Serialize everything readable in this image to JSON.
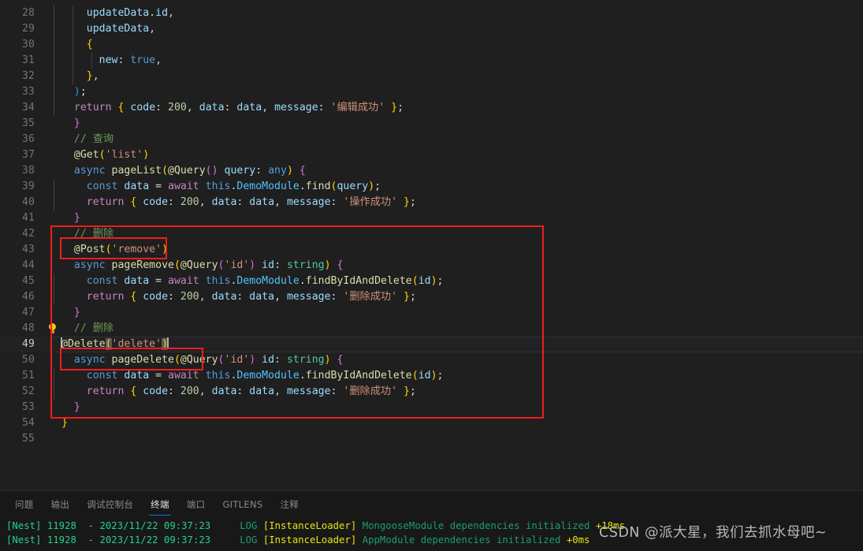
{
  "editor": {
    "first_visible_line": 28,
    "last_visible_line": 55,
    "active_line": 49,
    "lines": [
      {
        "num": "28",
        "text": "    updateData.id,"
      },
      {
        "num": "29",
        "text": "    updateData,"
      },
      {
        "num": "30",
        "text": "    {"
      },
      {
        "num": "31",
        "text": "      new: true,"
      },
      {
        "num": "32",
        "text": "    },"
      },
      {
        "num": "33",
        "text": "  );"
      },
      {
        "num": "34",
        "text": "  return { code: 200, data: data, message: '编辑成功' };"
      },
      {
        "num": "35",
        "text": "}"
      },
      {
        "num": "36",
        "text": "// 查询"
      },
      {
        "num": "37",
        "text": "@Get('list')"
      },
      {
        "num": "38",
        "text": "async pageList(@Query() query: any) {"
      },
      {
        "num": "39",
        "text": "  const data = await this.DemoModule.find(query);"
      },
      {
        "num": "40",
        "text": "  return { code: 200, data: data, message: '操作成功' };"
      },
      {
        "num": "41",
        "text": "}"
      },
      {
        "num": "42",
        "text": "// 删除"
      },
      {
        "num": "43",
        "text": "@Post('remove')"
      },
      {
        "num": "44",
        "text": "async pageRemove(@Query('id') id: string) {"
      },
      {
        "num": "45",
        "text": "  const data = await this.DemoModule.findByIdAndDelete(id);"
      },
      {
        "num": "46",
        "text": "  return { code: 200, data: data, message: '删除成功' };"
      },
      {
        "num": "47",
        "text": "}"
      },
      {
        "num": "48",
        "text": "// 删除"
      },
      {
        "num": "49",
        "text": "@Delete('delete')"
      },
      {
        "num": "50",
        "text": "async pageDelete(@Query('id') id: string) {"
      },
      {
        "num": "51",
        "text": "  const data = await this.DemoModule.findByIdAndDelete(id);"
      },
      {
        "num": "52",
        "text": "  return { code: 200, data: data, message: '删除成功' };"
      },
      {
        "num": "53",
        "text": "}"
      },
      {
        "num": "54",
        "text": "}"
      },
      {
        "num": "55",
        "text": ""
      }
    ],
    "tokens": {
      "const": "const",
      "await": "await",
      "return": "return",
      "async": "async",
      "new_prop": "new",
      "true": "true",
      "this": "this",
      "DemoModule": "DemoModule",
      "find": "find",
      "findByIdAndDelete": "findByIdAndDelete",
      "data": "data",
      "code": "code",
      "message": "message",
      "query": "query",
      "id": "id",
      "any": "any",
      "string": "string",
      "updateData": "updateData",
      "code_value": "200",
      "decorator_get": "@Get",
      "decorator_post": "@Post",
      "decorator_delete": "@Delete",
      "decorator_query": "@Query",
      "str_list": "'list'",
      "str_remove": "'remove'",
      "str_delete": "'delete'",
      "str_id": "'id'",
      "msg_edit": "'编辑成功'",
      "msg_op": "'操作成功'",
      "msg_del": "'删除成功'",
      "fn_pageList": "pageList",
      "fn_pageRemove": "pageRemove",
      "fn_pageDelete": "pageDelete",
      "comment_query": "// 查询",
      "comment_delete": "// 删除"
    },
    "quick_fix_line": 48,
    "quick_fix_icon": "lightbulb-icon"
  },
  "annotations": {
    "outer_box_label": "highlighted-delete-methods",
    "post_box_label": "post-remove-decorator",
    "delete_box_label": "delete-decorator",
    "color": "#f01c1c"
  },
  "panel": {
    "tabs": [
      {
        "label": "问题",
        "name": "tab-problems",
        "active": false
      },
      {
        "label": "输出",
        "name": "tab-output",
        "active": false
      },
      {
        "label": "调试控制台",
        "name": "tab-debug-console",
        "active": false
      },
      {
        "label": "终端",
        "name": "tab-terminal",
        "active": true
      },
      {
        "label": "端口",
        "name": "tab-ports",
        "active": false
      },
      {
        "label": "GITLENS",
        "name": "tab-gitlens",
        "active": false
      },
      {
        "label": "注释",
        "name": "tab-comments",
        "active": false
      }
    ],
    "active_tab": "终端",
    "accent_color": "#0078d4",
    "terminal_lines": [
      {
        "prefix": "[Nest]",
        "pid": "11928",
        "dash": "-",
        "timestamp": "2023/11/22 09:37:23",
        "level": "LOG",
        "context": "[InstanceLoader]",
        "message": "MongooseModule dependencies initialized",
        "elapsed": "+18ms"
      },
      {
        "prefix": "[Nest]",
        "pid": "11928",
        "dash": "-",
        "timestamp": "2023/11/22 09:37:23",
        "level": "LOG",
        "context": "[InstanceLoader]",
        "message": "AppModule dependencies initialized",
        "elapsed": "+0ms"
      }
    ]
  },
  "watermark": {
    "text": "CSDN @派大星，我们去抓水母吧~"
  }
}
